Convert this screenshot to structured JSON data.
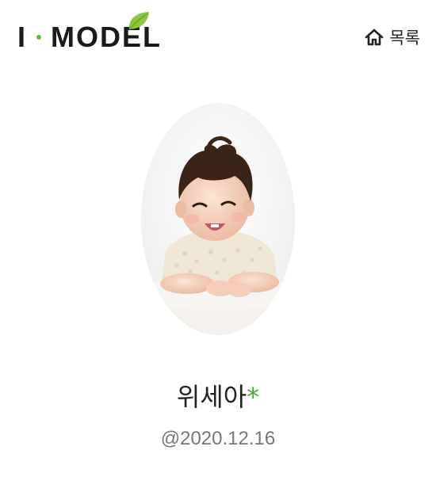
{
  "header": {
    "logo": {
      "letter_i": "I",
      "word": "MODEL",
      "accent_color": "#5cbf3c"
    },
    "home": {
      "label": "목록",
      "icon": "home-icon"
    }
  },
  "profile": {
    "photo": "baby-portrait",
    "name": "위세아",
    "name_mark": "*",
    "birth_date": "@2020.12.16",
    "mark_color": "#4aa83a"
  }
}
